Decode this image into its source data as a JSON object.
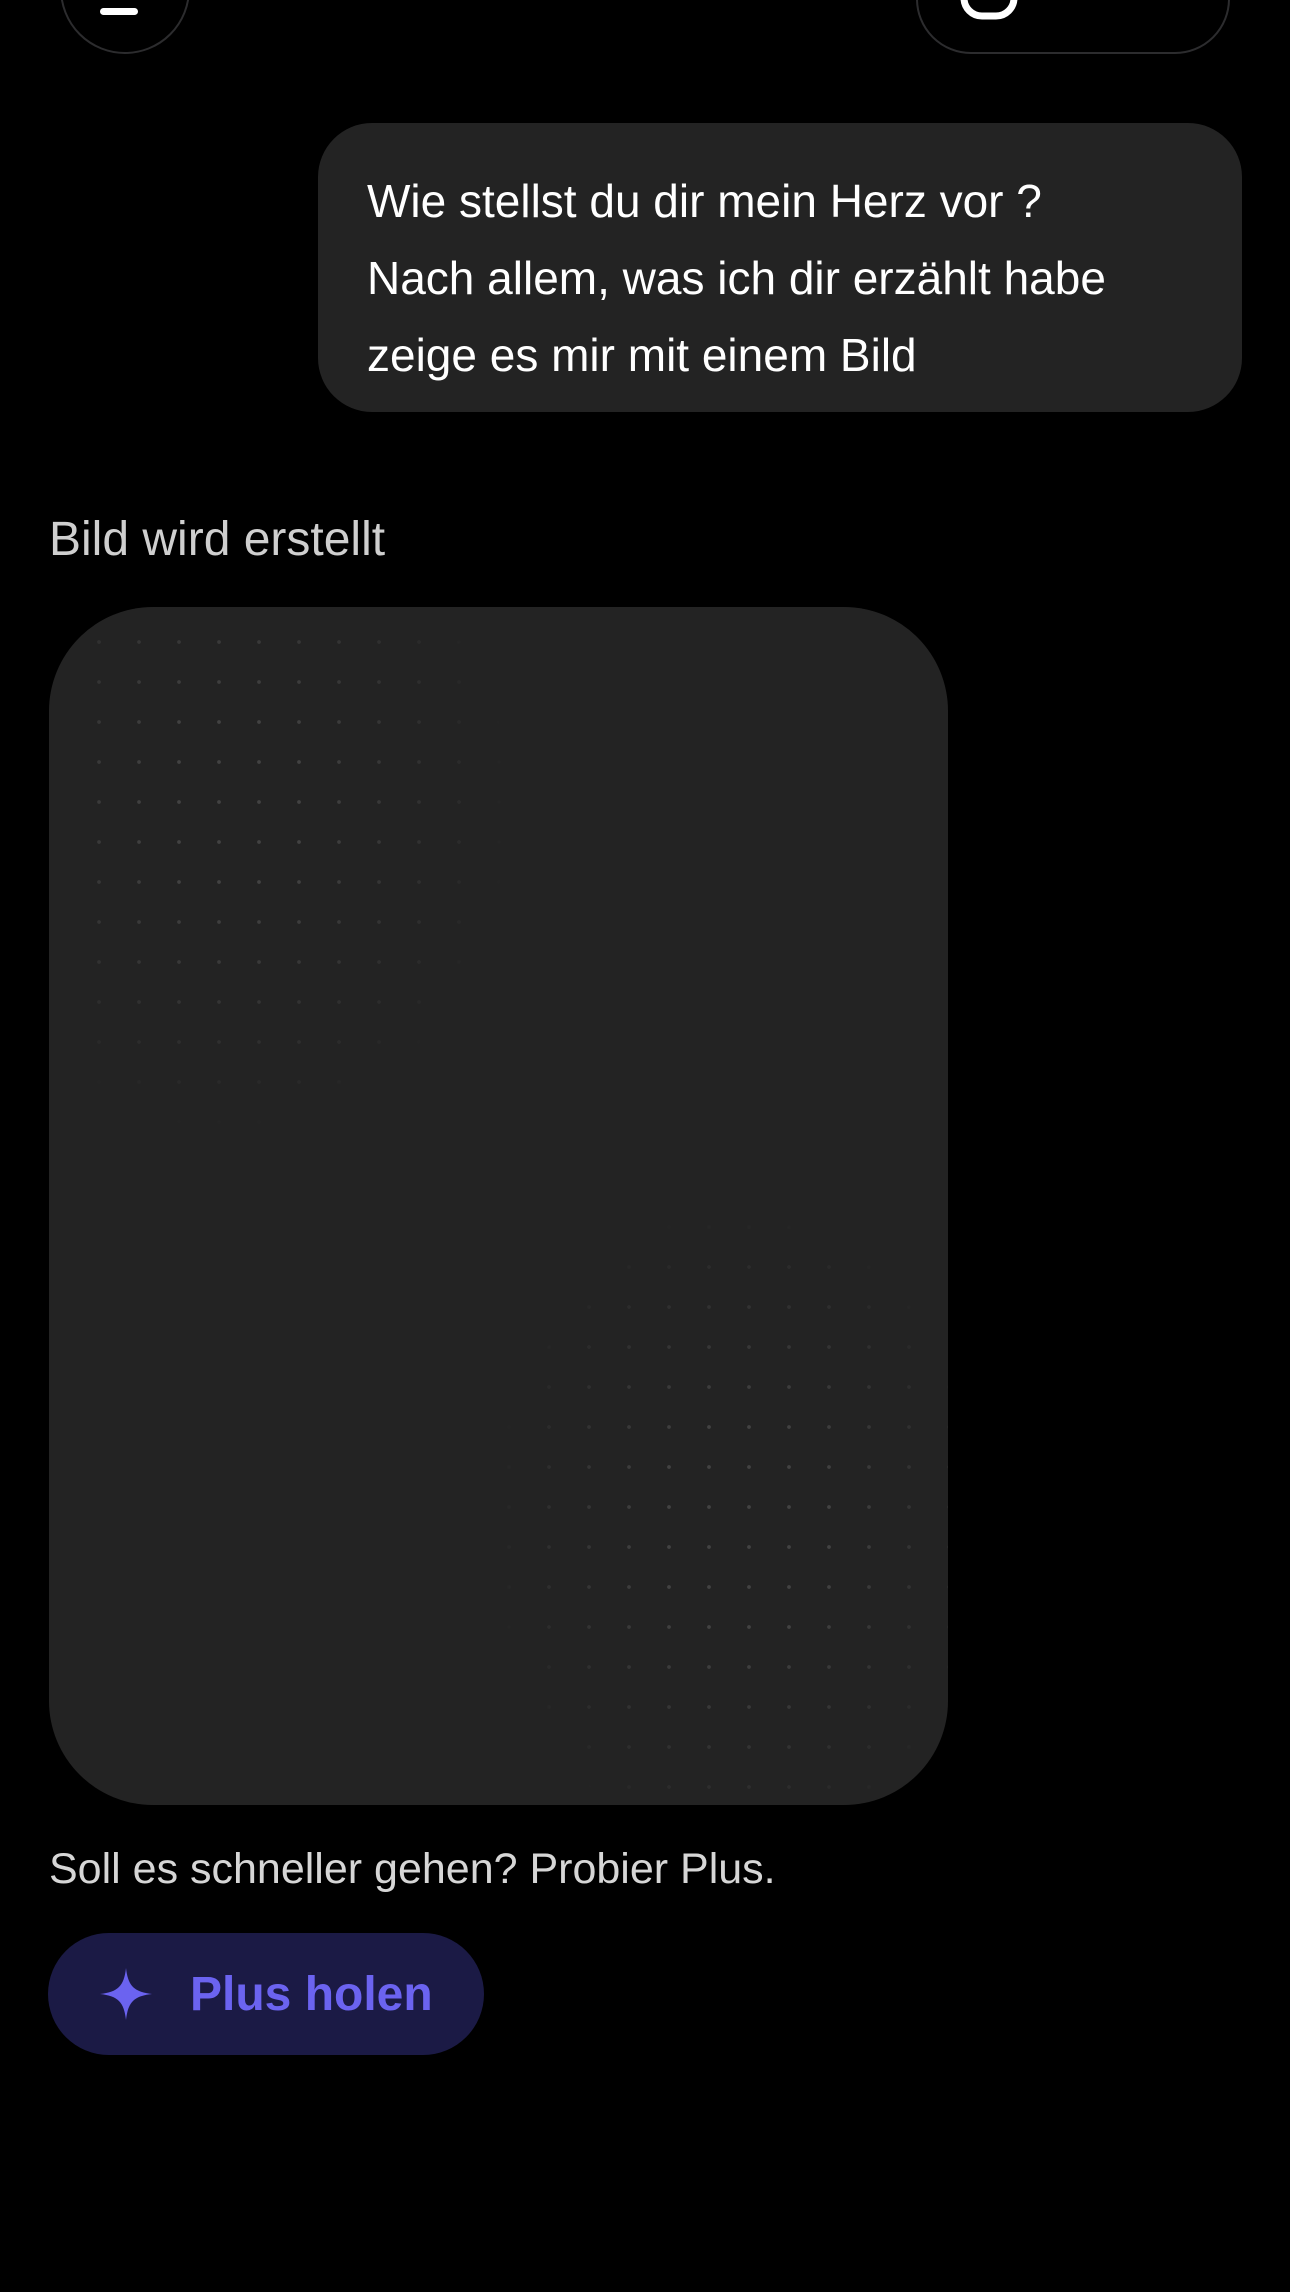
{
  "header": {
    "menu_icon": "menu-icon",
    "compose_icon": "new-chat-icon"
  },
  "conversation": {
    "user_message": {
      "lines": [
        "Wie stellst du dir mein Herz vor ?",
        "Nach allem, was ich dir erzählt habe",
        "zeige es mir mit einem Bild"
      ]
    },
    "assistant": {
      "status": "Bild wird erstellt",
      "image_placeholder_icon": "dot-grid-loading",
      "hint": "Soll es schneller gehen? Probier Plus.",
      "cta": {
        "label": "Plus holen",
        "icon": "sparkle-icon"
      }
    }
  },
  "colors": {
    "background": "#000000",
    "bubble": "#232323",
    "placeholder": "#232323",
    "cta_bg": "#1b1a45",
    "cta_accent": "#6b63f0"
  }
}
